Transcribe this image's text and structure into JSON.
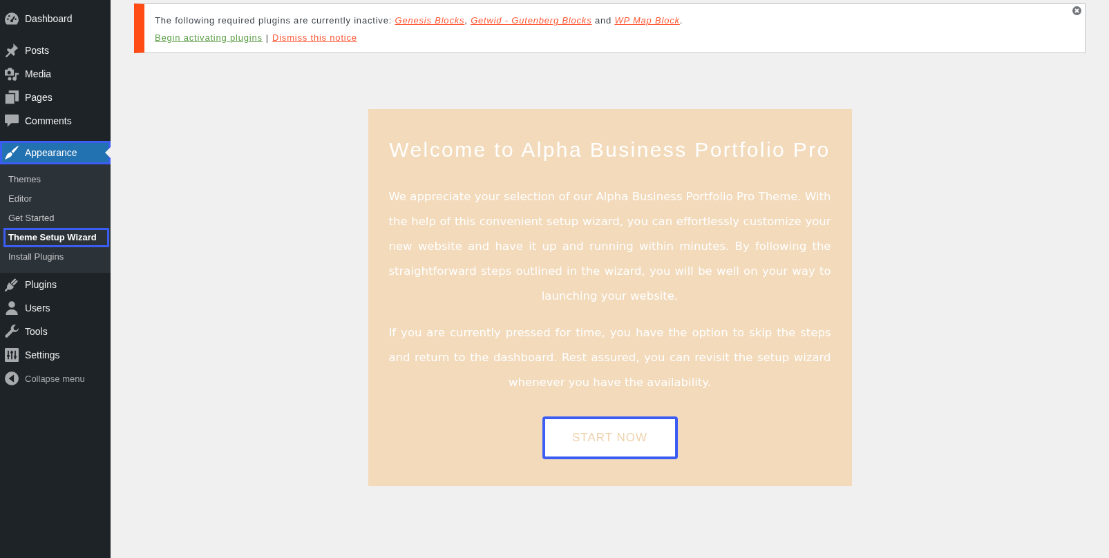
{
  "sidebar": {
    "items": [
      {
        "label": "Dashboard",
        "selected": false,
        "highlighted": false
      },
      {
        "label": "Posts",
        "selected": false,
        "highlighted": false
      },
      {
        "label": "Media",
        "selected": false,
        "highlighted": false
      },
      {
        "label": "Pages",
        "selected": false,
        "highlighted": false
      },
      {
        "label": "Comments",
        "selected": false,
        "highlighted": false
      },
      {
        "label": "Appearance",
        "selected": true,
        "highlighted": true,
        "submenu": [
          {
            "label": "Themes",
            "selected": false,
            "highlighted": false
          },
          {
            "label": "Editor",
            "selected": false,
            "highlighted": false
          },
          {
            "label": "Get Started",
            "selected": false,
            "highlighted": false
          },
          {
            "label": "Theme Setup Wizard",
            "selected": true,
            "highlighted": true
          },
          {
            "label": "Install Plugins",
            "selected": false,
            "highlighted": false
          }
        ]
      },
      {
        "label": "Plugins",
        "selected": false,
        "highlighted": false
      },
      {
        "label": "Users",
        "selected": false,
        "highlighted": false
      },
      {
        "label": "Tools",
        "selected": false,
        "highlighted": false
      },
      {
        "label": "Settings",
        "selected": false,
        "highlighted": false
      }
    ],
    "collapse_menu": {
      "label": "Collapse menu"
    }
  },
  "notice": {
    "message": [
      {
        "kind": "text",
        "text": "The following required plugins are currently inactive: "
      },
      {
        "kind": "link",
        "text": "Genesis Blocks"
      },
      {
        "kind": "text",
        "text": ", "
      },
      {
        "kind": "link",
        "text": "Getwid - Gutenberg Blocks"
      },
      {
        "kind": "text",
        "text": " and "
      },
      {
        "kind": "link",
        "text": "WP Map Block"
      },
      {
        "kind": "text",
        "text": "."
      }
    ],
    "actions": [
      {
        "label": "Begin activating plugins",
        "color": "#5b9e46"
      },
      {
        "label": "Dismiss this notice",
        "color": "#ff5733"
      }
    ],
    "action_separator": "|"
  },
  "welcome": {
    "title": "Welcome to Alpha Business Portfolio Pro",
    "paragraphs": [
      "We appreciate your selection of our Alpha Business Portfolio Pro Theme. With the help of this convenient setup wizard, you can effortlessly customize your new website and have it up and running within minutes. By following the straightforward steps outlined in the wizard, you will be well on your way to launching your website.",
      "If you are currently pressed for time, you have the option to skip the steps and return to the dashboard. Rest assured, you can revisit the setup wizard whenever you have the availability."
    ],
    "button": {
      "label": "START NOW",
      "highlighted": true
    }
  }
}
